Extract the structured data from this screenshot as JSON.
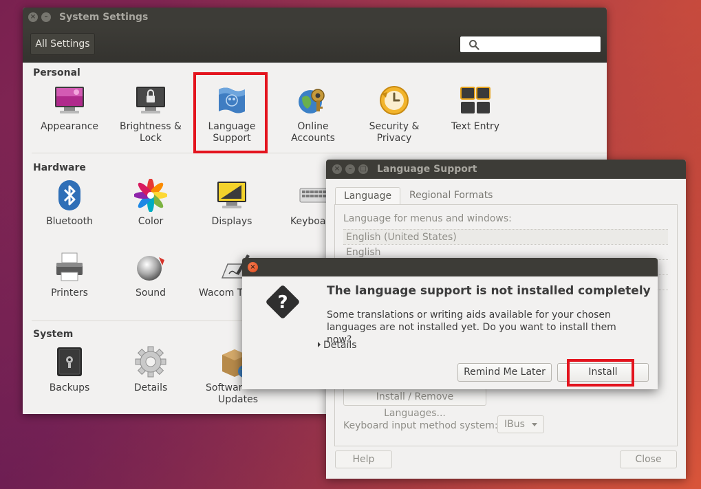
{
  "settings": {
    "window_title": "System Settings",
    "all_settings_label": "All Settings",
    "search_placeholder": "",
    "sections": {
      "personal": "Personal",
      "hardware": "Hardware",
      "system": "System"
    },
    "personal_items": [
      "Appearance",
      "Brightness & Lock",
      "Language Support",
      "Online Accounts",
      "Security & Privacy",
      "Text Entry"
    ],
    "hardware_items": [
      "Bluetooth",
      "Color",
      "Displays",
      "Keyboard",
      "Printers",
      "Sound",
      "Wacom Tablet"
    ],
    "system_items": [
      "Backups",
      "Details",
      "Software & Updates"
    ],
    "labels": {
      "appearance": "Appearance",
      "brightness_1": "Brightness &",
      "brightness_2": "Lock",
      "language_1": "Language",
      "language_2": "Support",
      "online_1": "Online",
      "online_2": "Accounts",
      "security_1": "Security &",
      "security_2": "Privacy",
      "text_entry": "Text Entry",
      "bluetooth": "Bluetooth",
      "color": "Color",
      "displays": "Displays",
      "keyboard_visible": "Keyboar",
      "printers": "Printers",
      "sound": "Sound",
      "wacom_visible": "Wacom Ta",
      "backups": "Backups",
      "details": "Details",
      "software_1_visible": "Softwar",
      "software_2": "Updates"
    },
    "highlighted_item": "Language Support",
    "highlight_color": "#e3141e"
  },
  "language_support": {
    "window_title": "Language Support",
    "tabs": [
      "Language",
      "Regional Formats"
    ],
    "active_tab": "Language",
    "menu_language_label": "Language for menus and windows:",
    "languages": [
      "English (United States)",
      "English"
    ],
    "install_remove_label": "Install / Remove Languages...",
    "input_method_label": "Keyboard input method system:",
    "input_method_value": "IBus",
    "help_label": "Help",
    "close_label": "Close"
  },
  "dialog": {
    "heading": "The language support is not installed completely",
    "body_line_1": "Some translations or writing aids available for your chosen",
    "body_line_2": "languages are not installed yet. Do you want to install them now?",
    "details_label": "Details",
    "remind_label": "Remind Me Later",
    "install_label": "Install",
    "highlighted_button": "Install"
  }
}
